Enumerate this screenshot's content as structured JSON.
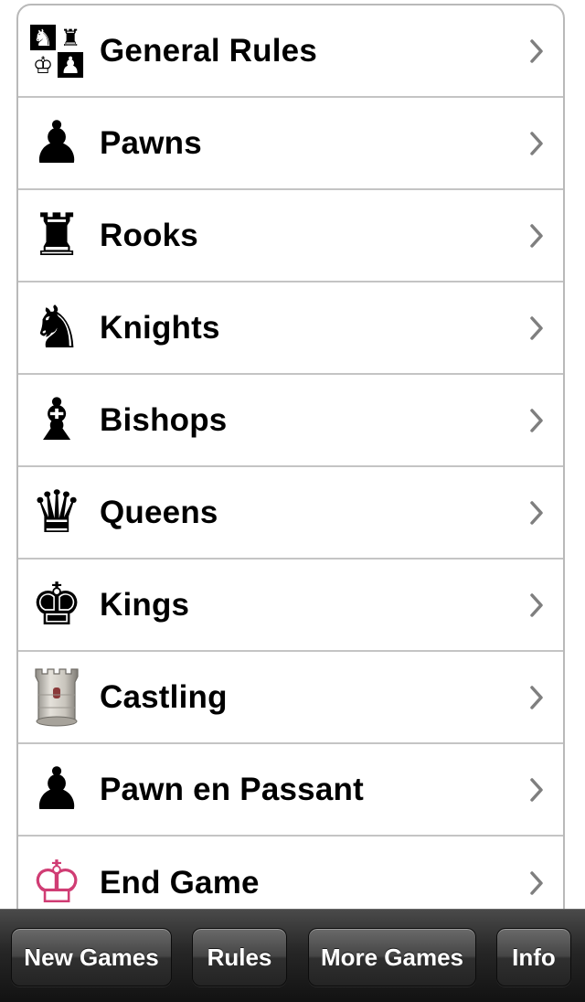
{
  "rules_list": {
    "items": [
      {
        "label": "General Rules",
        "icon": "general-rules-icon"
      },
      {
        "label": "Pawns",
        "icon": "pawn-icon"
      },
      {
        "label": "Rooks",
        "icon": "rook-icon"
      },
      {
        "label": "Knights",
        "icon": "knight-icon"
      },
      {
        "label": "Bishops",
        "icon": "bishop-icon"
      },
      {
        "label": "Queens",
        "icon": "queen-icon"
      },
      {
        "label": "Kings",
        "icon": "king-icon"
      },
      {
        "label": "Castling",
        "icon": "castle-tower-icon"
      },
      {
        "label": "Pawn en Passant",
        "icon": "pawn-icon"
      },
      {
        "label": "End Game",
        "icon": "king-outline-icon"
      }
    ]
  },
  "tab_bar": {
    "new_games": "New Games",
    "rules": "Rules",
    "more_games": "More Games",
    "info": "Info"
  },
  "colors": {
    "end_game_icon": "#d03d74",
    "chevron": "#7f7f7f",
    "tab_bar_background": "#262626"
  }
}
